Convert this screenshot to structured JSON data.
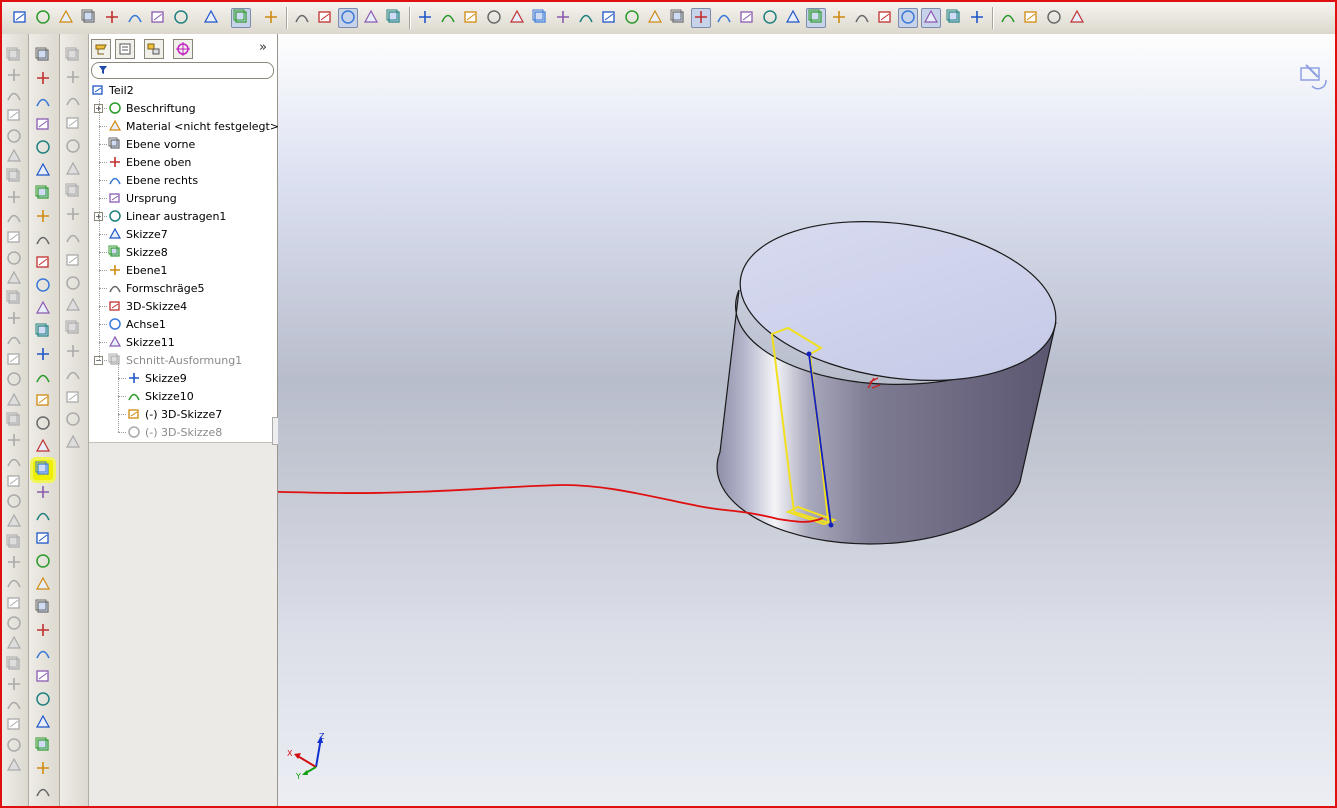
{
  "window": {
    "accent_outline": "#e01010",
    "viewport_colors": [
      "#fefefe",
      "#dde2f2",
      "#b8bdcc",
      "#eceef4"
    ]
  },
  "toolbar": {
    "groups": [
      [
        "new-icon",
        "open-icon",
        "save-icon",
        "print-setup-icon",
        "options-icon",
        "print-icon",
        "print-preview-icon",
        "undo-icon",
        "redo-icon",
        "select-icon",
        "rebuild-icon"
      ],
      [
        "properties-icon",
        "help-icon",
        "sketch-icon",
        "smart-dimension-icon",
        "3d-sketch-icon"
      ],
      [
        "appearance-icon",
        "color-icon",
        "view-orientation-icon",
        "isometric-icon",
        "trimetric-icon",
        "dimetric-icon",
        "front-view-icon",
        "back-view-icon",
        "top-view-icon",
        "normal-to-icon",
        "section-view-icon",
        "hidden-lines-icon",
        "shaded-edges-icon",
        "shaded-icon",
        "realview-icon",
        "shadows-icon",
        "display-style-icon",
        "planes-icon",
        "axes-icon",
        "origins-icon",
        "points-icon",
        "sketches-icon",
        "3d-sketches-icon",
        "curves-icon",
        "sketch-relations-icon"
      ],
      [
        "photoworks-icon",
        "3d-content-icon",
        "solidworks-3d-icon",
        "toolbox-icon"
      ]
    ]
  },
  "left_toolbar_1": {
    "icons": [
      "extrude-icon",
      "revolve-icon",
      "sweep-icon",
      "loft-icon",
      "boundary-icon",
      "cut-extrude-icon",
      "cut-revolve-icon",
      "cut-sweep-icon",
      "cut-loft-icon",
      "fillet-icon",
      "chamfer-icon",
      "rib-icon",
      "draft-icon",
      "shell-icon",
      "wrap-icon",
      "dome-icon",
      "flex-icon",
      "deform-icon",
      "indent-icon",
      "move-face-icon",
      "scale-icon",
      "linear-pattern-icon",
      "circular-pattern-icon",
      "mirror-icon",
      "curve-pattern-icon",
      "sketch-pattern-icon",
      "table-pattern-icon",
      "fill-pattern-icon",
      "split-icon",
      "combine-icon",
      "intersect-icon",
      "delete-body-icon",
      "move-copy-icon",
      "reference-geometry-icon",
      "curves-icon",
      "instant3d-icon"
    ]
  },
  "left_toolbar_2": {
    "icons": [
      "sketch-icon",
      "3d-sketch-icon",
      "smart-dimension-icon",
      "line-icon",
      "rectangle-icon",
      "parallelogram-icon",
      "circle-icon",
      "polygon-icon",
      "ellipse-icon",
      "partial-ellipse-icon",
      "arc-icon",
      "tangent-arc-icon",
      "3-point-arc-icon",
      "centerline-icon",
      "construction-line-icon",
      "straight-slot-icon",
      "centerpoint-slot-icon",
      "spline-icon",
      "spline-on-surface-icon",
      "point-icon",
      "parabola-icon",
      "linear-sketch-pattern-icon",
      "circular-sketch-pattern-icon",
      "add-relation-icon",
      "display-relations-icon",
      "trim-icon",
      "convert-entities-icon",
      "offset-entities-icon",
      "mirror-entities-icon",
      "move-entities-icon",
      "stretch-icon",
      "modify-sketch-icon",
      "sketch-picture-icon"
    ],
    "highlighted": "spline-on-surface-icon"
  },
  "left_toolbar_3": {
    "icons": [
      "extruded-surface-icon",
      "revolved-surface-icon",
      "swept-surface-icon",
      "lofted-surface-icon",
      "planar-surface-icon",
      "offset-surface-icon",
      "ruled-surface-icon",
      "knit-surface-icon",
      "fill-surface-icon",
      "delete-face-icon",
      "trim-surface-icon",
      "untrim-surface-icon",
      "extend-surface-icon",
      "thicken-icon",
      "thickened-cut-icon",
      "replace-face-icon",
      "radiate-surface-icon",
      "mid-surface-icon"
    ]
  },
  "feature_manager": {
    "tabs": [
      "featuremanager-tab-icon",
      "propertymanager-tab-icon",
      "configurationmanager-tab-icon",
      "dimxpert-tab-icon"
    ],
    "expand_glyph": "»",
    "filter_icon": "filter-icon",
    "tree": [
      {
        "label": "Teil2",
        "icon": "part-icon",
        "level": 0
      },
      {
        "label": "Beschriftung",
        "icon": "annotations-icon",
        "level": 1,
        "expander": "+"
      },
      {
        "label": "Material <nicht festgelegt>",
        "icon": "material-icon",
        "level": 1
      },
      {
        "label": "Ebene vorne",
        "icon": "plane-icon",
        "level": 1
      },
      {
        "label": "Ebene oben",
        "icon": "plane-icon",
        "level": 1
      },
      {
        "label": "Ebene rechts",
        "icon": "plane-icon",
        "level": 1
      },
      {
        "label": "Ursprung",
        "icon": "origin-icon",
        "level": 1
      },
      {
        "label": "Linear austragen1",
        "icon": "extrude-feature-icon",
        "level": 1,
        "expander": "+"
      },
      {
        "label": "Skizze7",
        "icon": "sketch-icon",
        "level": 1
      },
      {
        "label": "Skizze8",
        "icon": "sketch-icon",
        "level": 1
      },
      {
        "label": "Ebene1",
        "icon": "plane-feature-icon",
        "level": 1
      },
      {
        "label": "Formschräge5",
        "icon": "draft-feature-icon",
        "level": 1
      },
      {
        "label": "3D-Skizze4",
        "icon": "3d-sketch-icon",
        "level": 1
      },
      {
        "label": "Achse1",
        "icon": "axis-icon",
        "level": 1
      },
      {
        "label": "Skizze11",
        "icon": "sketch-icon",
        "level": 1
      },
      {
        "label": "Schnitt-Ausformung1",
        "icon": "cut-loft-feature-icon",
        "level": 1,
        "expander": "−",
        "greyed": true
      },
      {
        "label": "Skizze9",
        "icon": "sketch-icon",
        "level": 2
      },
      {
        "label": "Skizze10",
        "icon": "sketch-icon",
        "level": 2
      },
      {
        "label": "(-) 3D-Skizze7",
        "icon": "3d-sketch-icon",
        "level": 2
      },
      {
        "label": "(-) 3D-Skizze8",
        "icon": "3d-sketch-icon",
        "level": 2,
        "greyed": true
      }
    ]
  },
  "viewport": {
    "model": "cylinder",
    "model_colors": {
      "top_face": "#c8cde9",
      "side_dark": "#5a5670",
      "side_light": "#f4f4f8",
      "edge": "#1a1a1a"
    },
    "selection_color": "#f0e020",
    "sketch_line_color": "#1420c0",
    "annotation_stroke_color": "#e01010",
    "triad_axes": [
      "X",
      "Y",
      "Z"
    ],
    "triad_colors": {
      "x": "#d01010",
      "y": "#10a010",
      "z": "#1030d0"
    },
    "heads_up_icon": "view-orientation-corner-icon"
  }
}
